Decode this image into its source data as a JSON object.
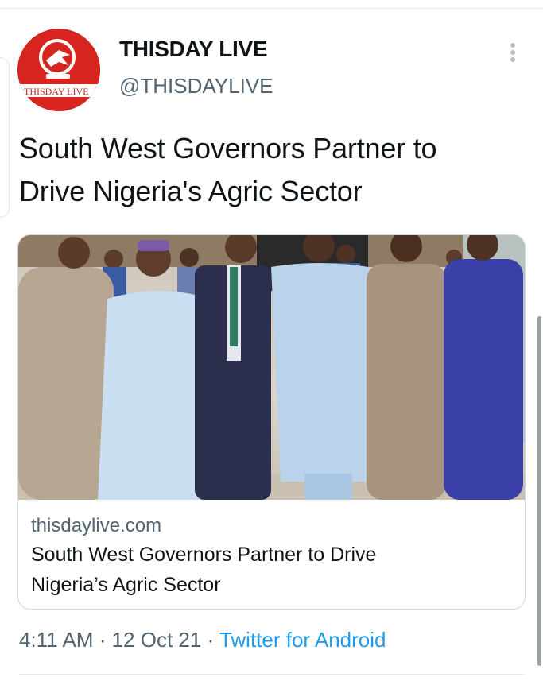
{
  "account": {
    "display_name": "THISDAY LIVE",
    "handle": "@THISDAYLIVE",
    "logo_text": "THISDAY LIVE"
  },
  "tweet": {
    "text_line1": "South West Governors Partner to",
    "text_line2": "Drive Nigeria's Agric Sector"
  },
  "card": {
    "image_icon": "photo-of-seven-men-group",
    "domain": "thisdaylive.com",
    "title_line1": "South West Governors Partner to Drive",
    "title_line2": "Nigeria’s Agric Sector"
  },
  "meta": {
    "time": "4:11 AM",
    "sep1": " · ",
    "date": "12 Oct 21",
    "sep2": " · ",
    "source": "Twitter for Android"
  },
  "icons": {
    "more": "more-vertical-icon"
  },
  "colors": {
    "brand_red": "#d6241f",
    "link_blue": "#1d9bf0",
    "secondary_text": "#536471"
  }
}
